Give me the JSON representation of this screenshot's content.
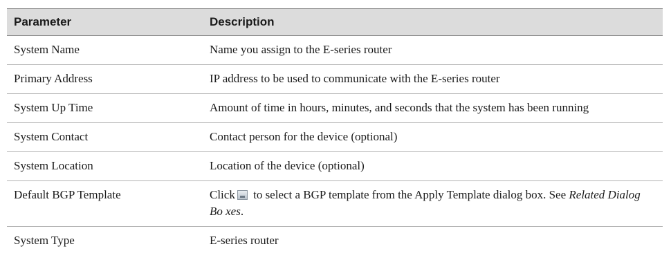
{
  "table": {
    "header": {
      "parameter": "Parameter",
      "description": "Description"
    },
    "rows": [
      {
        "parameter": "System Name",
        "description": "Name you assign to the E-series router"
      },
      {
        "parameter": "Primary Address",
        "description": "IP address to be used to communicate with the E-series router"
      },
      {
        "parameter": "System Up Time",
        "description": "Amount of time in hours, minutes, and seconds that the system has been running"
      },
      {
        "parameter": "System Contact",
        "description": "Contact person for the device (optional)"
      },
      {
        "parameter": "System Location",
        "description": "Location of the device (optional)"
      },
      {
        "parameter": "Default BGP Template",
        "description_before_icon": "Click",
        "icon": "browse-button-icon",
        "description_after_icon": " to select a BGP template from the Apply Template dialog box. See ",
        "description_link": "Related Dialog Bo xes",
        "description_end": "."
      },
      {
        "parameter": "System Type",
        "description": "E-series router"
      }
    ]
  }
}
